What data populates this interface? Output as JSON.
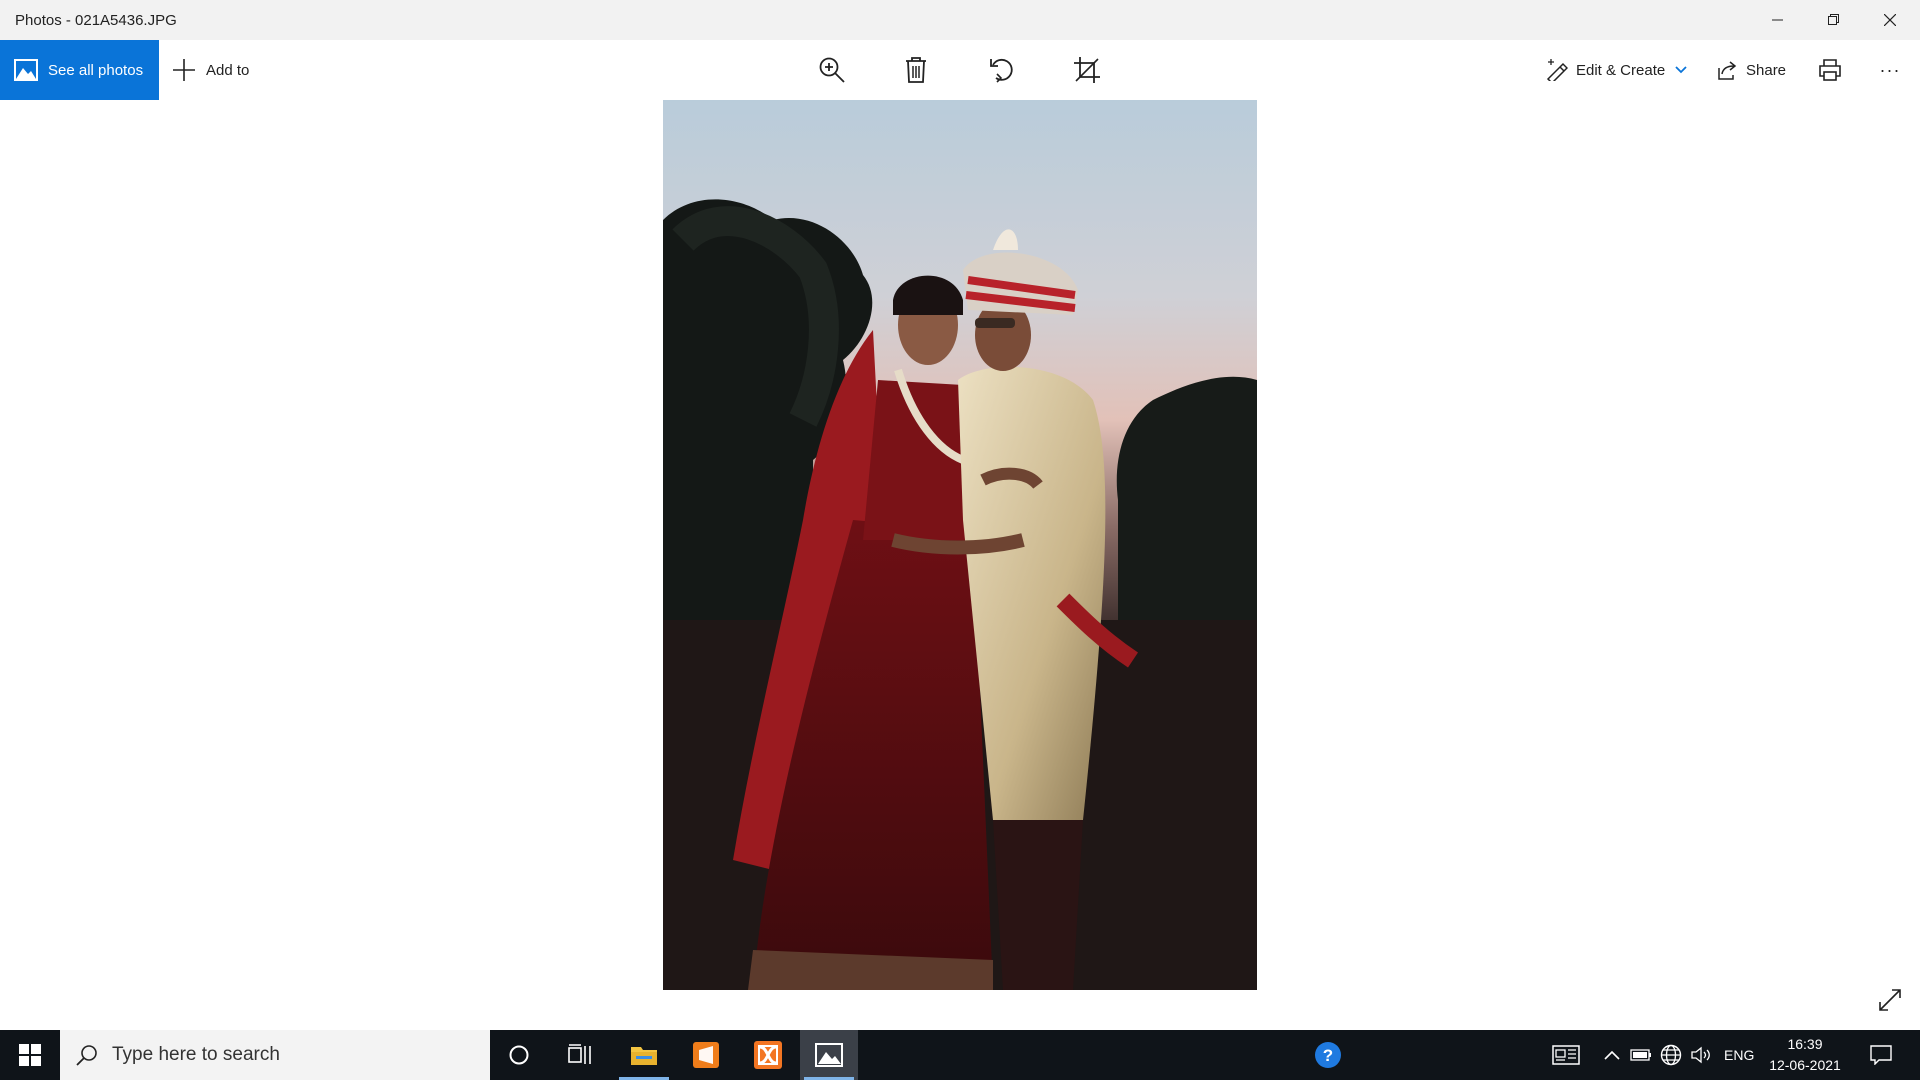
{
  "window": {
    "title": "Photos - 021A5436.JPG"
  },
  "commandbar": {
    "see_all_photos": "See all photos",
    "add_to": "Add to",
    "edit_create": "Edit & Create",
    "share": "Share",
    "more": "···"
  },
  "icons": {
    "see_all": "photo-icon",
    "add": "plus-icon",
    "zoom": "zoom-in-icon",
    "delete": "trash-icon",
    "rotate": "rotate-icon",
    "crop": "crop-icon",
    "edit": "edit-create-icon",
    "share": "share-icon",
    "print": "printer-icon",
    "expand": "expand-icon"
  },
  "taskbar": {
    "search_placeholder": "Type here to search",
    "language": "ENG",
    "time": "16:39",
    "date": "12-06-2021"
  },
  "colors": {
    "accent": "#0a74d8",
    "titlebar": "#f2f2f2",
    "taskbar": "#0f1419"
  }
}
